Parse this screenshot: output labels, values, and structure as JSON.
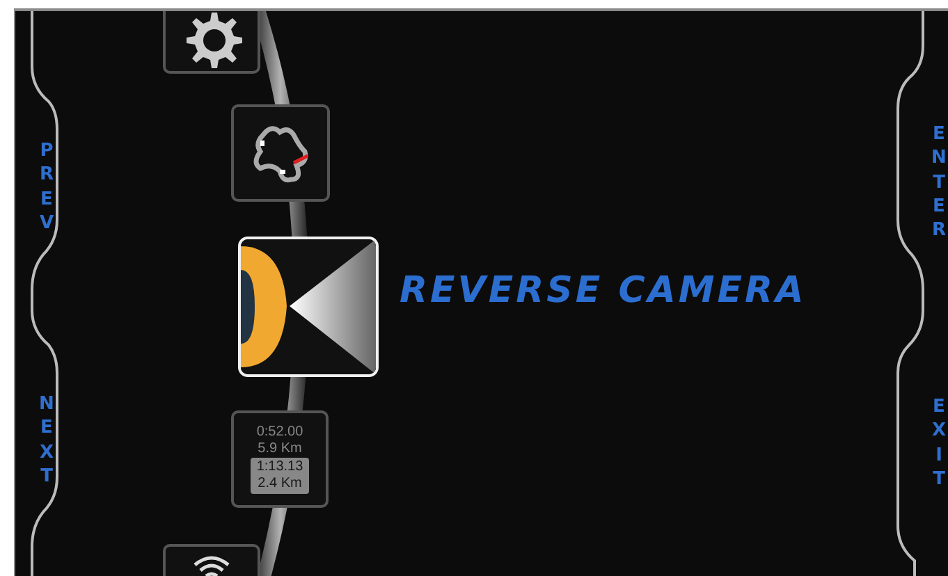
{
  "side_buttons": [
    {
      "label": "PREV"
    },
    {
      "label": "NEXT"
    },
    {
      "label": "ENTER"
    },
    {
      "label": "EXIT"
    }
  ],
  "menu_items": [
    {
      "kind": "gear",
      "selected": false
    },
    {
      "kind": "track",
      "selected": false
    },
    {
      "kind": "camera",
      "selected": true
    },
    {
      "kind": "trip",
      "selected": false,
      "lines": [
        "0:52.00",
        "5.9 Km"
      ],
      "highlight_lines": [
        "1:13.13",
        "2.4 Km"
      ]
    },
    {
      "kind": "wifi",
      "selected": false
    }
  ],
  "title": "REVERSE CAMERA"
}
